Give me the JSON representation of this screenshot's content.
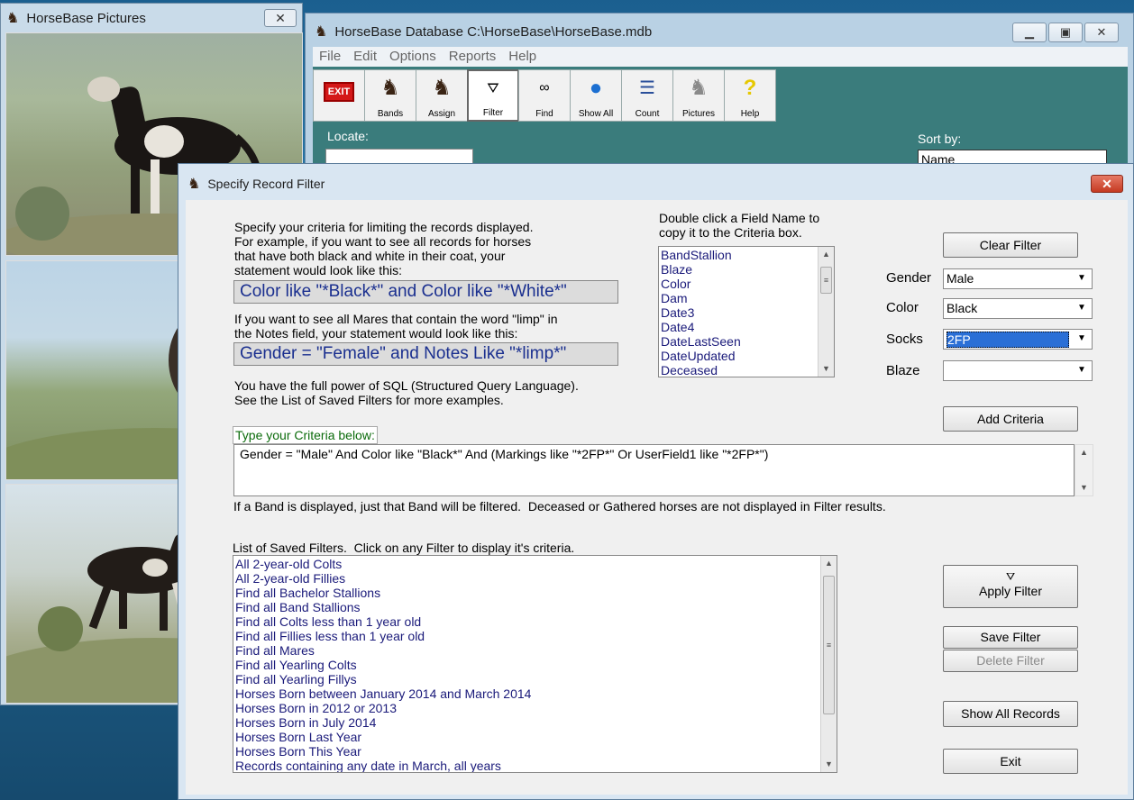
{
  "pictures_window": {
    "title": "HorseBase Pictures",
    "close": "✕"
  },
  "main_window": {
    "title": "HorseBase Database  C:\\HorseBase\\HorseBase.mdb",
    "menu": [
      "File",
      "Edit",
      "Options",
      "Reports",
      "Help"
    ],
    "toolbar": [
      {
        "label": "",
        "icon": "exit-icon"
      },
      {
        "label": "Bands",
        "icon": "horse-icon"
      },
      {
        "label": "Assign",
        "icon": "horse-icon"
      },
      {
        "label": "Filter",
        "icon": "filter-icon"
      },
      {
        "label": "Find",
        "icon": "binoculars-icon"
      },
      {
        "label": "Show All",
        "icon": "globe-icon"
      },
      {
        "label": "Count",
        "icon": "list-icon"
      },
      {
        "label": "Pictures",
        "icon": "horse-photo-icon"
      },
      {
        "label": "Help",
        "icon": "question-icon"
      }
    ],
    "exit_text": "EXIT",
    "locate_label": "Locate:",
    "sortby_label": "Sort by:",
    "sortby_value": "Name"
  },
  "dialog": {
    "title": "Specify Record Filter",
    "intro": [
      "Specify your criteria for limiting the records displayed.",
      "For example, if you want to see all records for horses",
      "that have both black and white in their coat, your",
      "statement would look like this:"
    ],
    "example1": "Color like \"*Black*\" and Color like \"*White*\"",
    "mares_text": [
      "If you want to see all Mares that contain the word \"limp\" in",
      "the Notes field, your statement would look like this:"
    ],
    "example2": "Gender = \"Female\" and Notes Like \"*limp*\"",
    "sql_text": [
      "You have the full power of SQL (Structured Query Language).",
      "See the List of Saved Filters for more examples."
    ],
    "field_hint": [
      "Double click a Field Name to",
      "copy it to the Criteria box."
    ],
    "fields": [
      "BandStallion",
      "Blaze",
      "Color",
      "Dam",
      "Date3",
      "Date4",
      "DateLastSeen",
      "DateUpdated",
      "Deceased"
    ],
    "clear_filter": "Clear Filter",
    "gender_label": "Gender",
    "gender_value": "Male",
    "color_label": "Color",
    "color_value": "Black",
    "socks_label": "Socks",
    "socks_value": "2FP",
    "blaze_label": "Blaze",
    "blaze_value": "",
    "add_criteria": "Add Criteria",
    "criteria_label": "Type your Criteria below:",
    "criteria_value": "Gender = \"Male\"  And Color like \"Black*\"  And (Markings like \"*2FP*\" Or UserField1 like \"*2FP*\")",
    "band_note": "If a Band is displayed, just that Band will be filtered.  Deceased or Gathered horses are not displayed in Filter results.",
    "saved_label": "List of Saved Filters.  Click on any Filter to display it's criteria.",
    "saved_filters": [
      "All 2-year-old Colts",
      "All 2-year-old Fillies",
      "Find all Bachelor Stallions",
      "Find all Band Stallions",
      "Find all Colts less than 1 year old",
      "Find all Fillies less than 1 year old",
      "Find all Mares",
      "Find all Yearling Colts",
      "Find all Yearling Fillys",
      "Horses Born between January 2014 and March 2014",
      "Horses Born in 2012 or 2013",
      "Horses Born in July 2014",
      "Horses Born Last Year",
      "Horses Born This Year",
      "Records containing any date in March, all years"
    ],
    "apply_filter": "Apply Filter",
    "save_filter": "Save Filter",
    "delete_filter": "Delete Filter",
    "show_all": "Show All Records",
    "exit": "Exit"
  }
}
